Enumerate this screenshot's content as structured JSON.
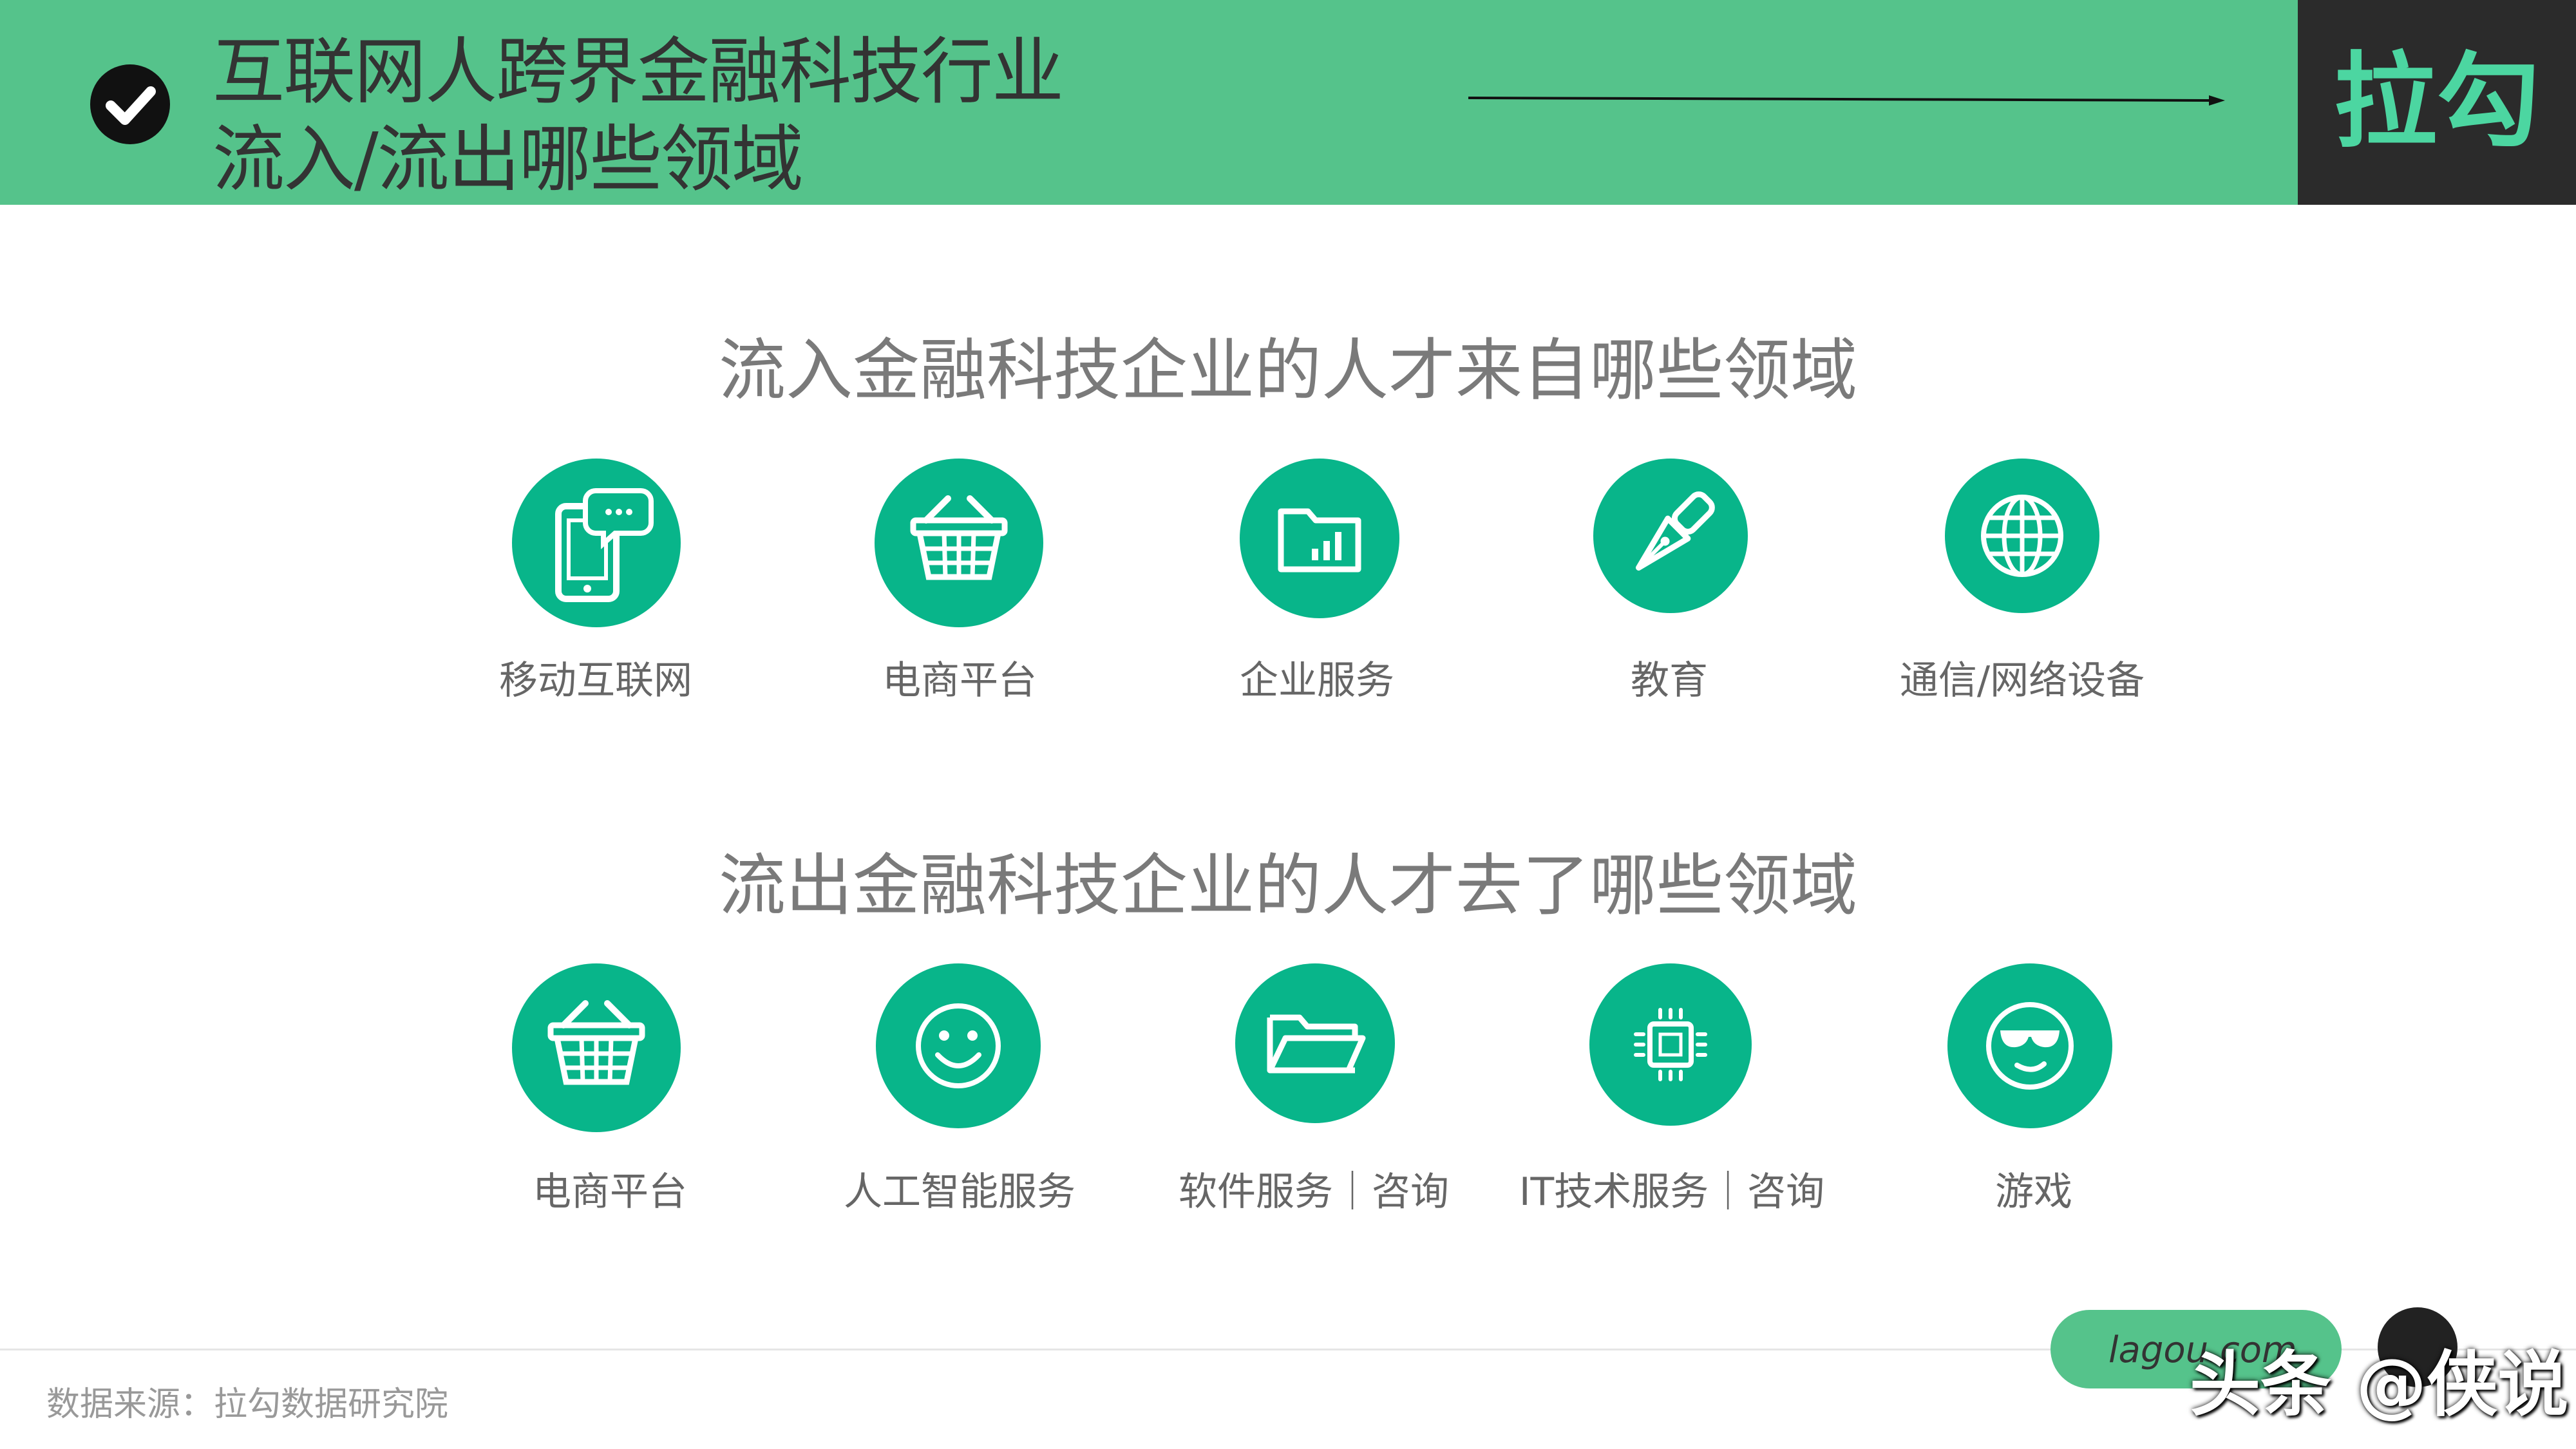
{
  "header": {
    "title_line1": "互联网人跨界金融科技行业",
    "title_line2": "流入/流出哪些领域",
    "check_icon": "check-circle-icon",
    "brand": "拉勾"
  },
  "colors": {
    "header_green": "#55c38b",
    "icon_green": "#08b58a",
    "brand_green": "#4cd6a1",
    "brand_box": "#2b2b2b"
  },
  "inflow": {
    "title": "流入金融科技企业的人才来自哪些领域",
    "items": [
      {
        "label": "移动互联网",
        "icon": "mobile-chat-icon"
      },
      {
        "label": "电商平台",
        "icon": "shopping-basket-icon"
      },
      {
        "label": "企业服务",
        "icon": "folder-chart-icon"
      },
      {
        "label": "教育",
        "icon": "pen-nib-icon"
      },
      {
        "label": "通信/网络设备",
        "icon": "globe-icon"
      }
    ]
  },
  "outflow": {
    "title": "流出金融科技企业的人才去了哪些领域",
    "items": [
      {
        "label": "电商平台",
        "icon": "shopping-basket-icon"
      },
      {
        "label": "人工智能服务",
        "icon": "smiley-icon"
      },
      {
        "label": "软件服务｜咨询",
        "icon": "open-folder-icon"
      },
      {
        "label": "IT技术服务｜咨询",
        "icon": "chip-icon"
      },
      {
        "label": "游戏",
        "icon": "sunglasses-face-icon"
      }
    ]
  },
  "footer": {
    "source": "数据来源：拉勾数据研究院",
    "site": "lagou.com",
    "watermark": "头条 @侠说"
  }
}
